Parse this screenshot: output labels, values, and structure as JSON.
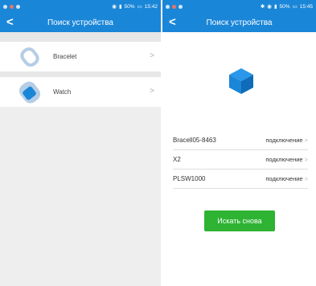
{
  "left_screen": {
    "status": {
      "time": "15:42",
      "battery": "50%"
    },
    "title": "Поиск устройства",
    "devices": [
      {
        "name": "Bracelet",
        "icon": "bracelet-icon"
      },
      {
        "name": "Watch",
        "icon": "watch-icon"
      }
    ]
  },
  "right_screen": {
    "status": {
      "time": "15:45",
      "battery": "50%"
    },
    "title": "Поиск устройства",
    "found_devices": [
      {
        "name": "Bracell05-8463",
        "action": "подключение"
      },
      {
        "name": "X2",
        "action": "подключение"
      },
      {
        "name": "PLSW1000",
        "action": "подключение"
      }
    ],
    "search_again_label": "Искать снова"
  },
  "colors": {
    "appbar": "#1a86d8",
    "button": "#2eb333",
    "background": "#eeeeee"
  }
}
